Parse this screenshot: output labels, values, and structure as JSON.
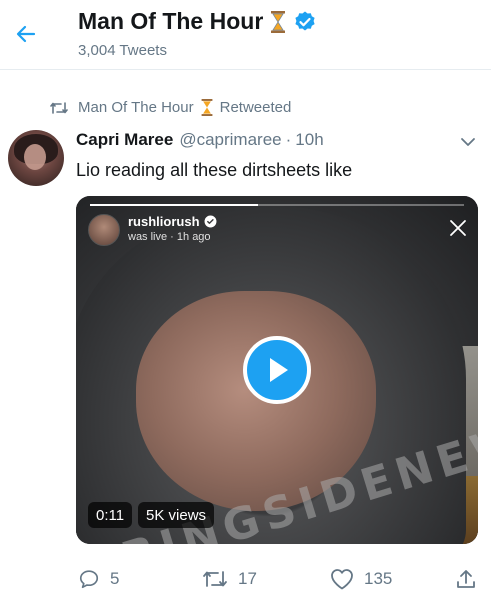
{
  "header": {
    "title": "Man Of The Hour",
    "tweet_count": "3,004 Tweets",
    "back_icon": "arrow-left-icon",
    "emoji_icon": "hourglass-icon",
    "verified_icon": "verified-badge-icon"
  },
  "retweet": {
    "name": "Man Of The Hour",
    "label": "Retweeted"
  },
  "tweet": {
    "author_name": "Capri Maree",
    "handle": "@caprimaree",
    "separator": "·",
    "time": "10h",
    "text": "Lio reading all these dirtsheets like"
  },
  "video": {
    "live_username": "rushliorush",
    "live_subtext": "was live · 1h ago",
    "duration": "0:11",
    "views": "5K views",
    "progress": 0.45,
    "watermark": "RINGSIDENEWS"
  },
  "actions": {
    "replies": "5",
    "retweets": "17",
    "likes": "135"
  },
  "colors": {
    "accent": "#1da1f2",
    "muted": "#657786",
    "text": "#14171a",
    "hourglass": "#f5a623"
  }
}
